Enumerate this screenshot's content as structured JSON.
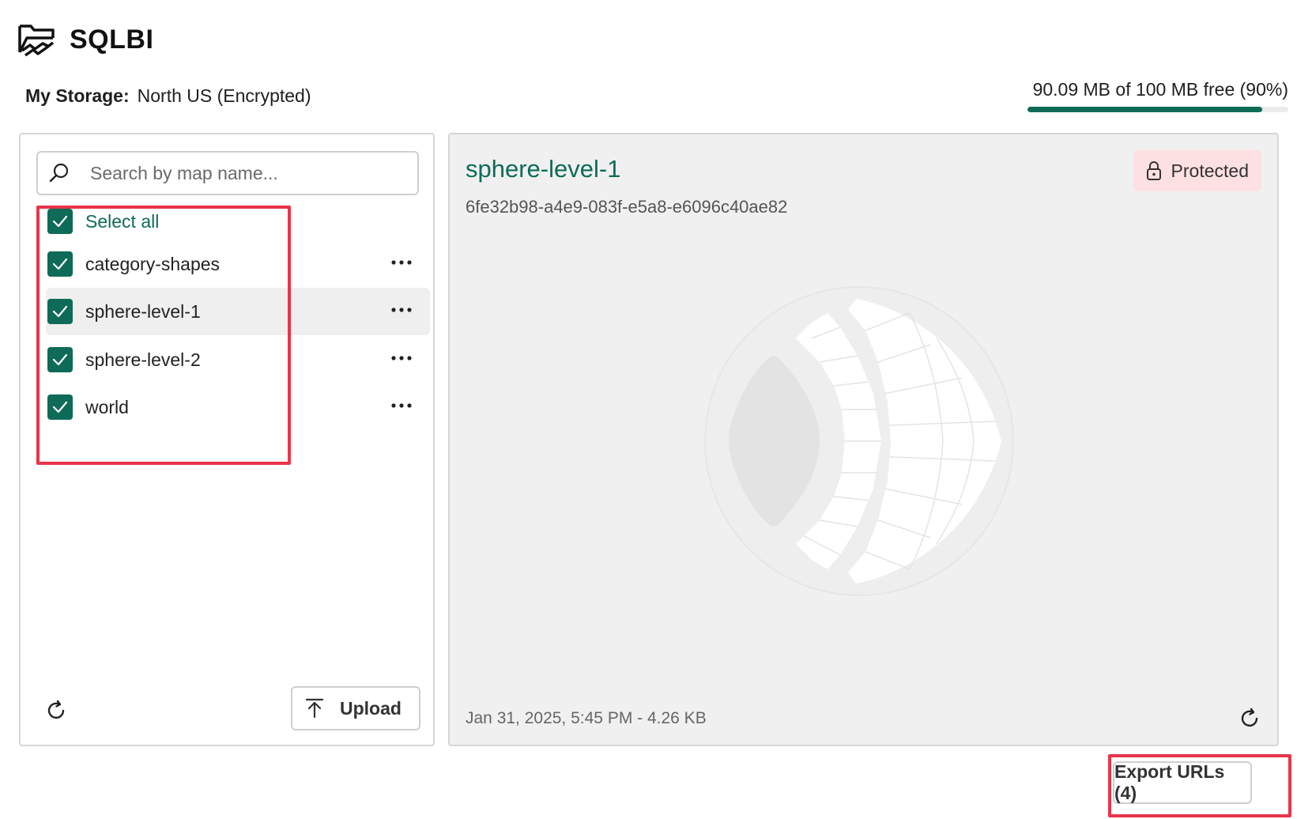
{
  "app": {
    "brand": "SQLBI",
    "icon": "folder-map-icon"
  },
  "storage": {
    "label": "My Storage:",
    "region": "North US (Encrypted)",
    "quota_text": "90.09 MB of 100 MB free (90%)",
    "used_fraction": 0.9
  },
  "search": {
    "placeholder": "Search by map name..."
  },
  "list": {
    "select_all": "Select all",
    "select_all_checked": true,
    "items": [
      {
        "name": "category-shapes",
        "checked": true,
        "selected": false
      },
      {
        "name": "sphere-level-1",
        "checked": true,
        "selected": true
      },
      {
        "name": "sphere-level-2",
        "checked": true,
        "selected": false
      },
      {
        "name": "world",
        "checked": true,
        "selected": false
      }
    ]
  },
  "left_footer": {
    "upload_label": "Upload"
  },
  "detail": {
    "title": "sphere-level-1",
    "id": "6fe32b98-a4e9-083f-e5a8-e6096c40ae82",
    "badge": "Protected",
    "meta": "Jan 31, 2025, 5:45 PM - 4.26 KB"
  },
  "footer": {
    "export_label": "Export URLs (4)"
  },
  "colors": {
    "accent": "#0e6b57",
    "badge_bg": "#fde0e2",
    "highlight": "#e8354a"
  }
}
